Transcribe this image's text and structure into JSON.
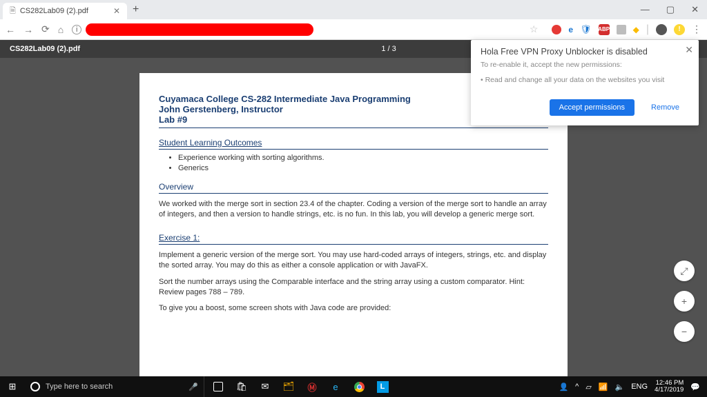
{
  "tab": {
    "title": "CS282Lab09 (2).pdf"
  },
  "windowControls": {
    "min": "—",
    "max": "▢",
    "close": "✕"
  },
  "pdfBar": {
    "filename": "CS282Lab09 (2).pdf",
    "pages": "1 / 3"
  },
  "doc": {
    "title1": "Cuyamaca College CS-282 Intermediate Java Programming",
    "title2": "John Gerstenberg, Instructor",
    "title3": "Lab #9",
    "slo_head": "Student Learning Outcomes",
    "slo1": "Experience working with sorting algorithms.",
    "slo2": "Generics",
    "overview_head": "Overview",
    "overview_body": "We worked with the merge sort in section 23.4 of the chapter. Coding a version of the merge sort to handle an array of integers, and then a version to handle strings, etc. is no fun. In this lab, you will develop a generic merge sort.",
    "ex1_head": "Exercise 1:",
    "ex1_p1": "Implement a generic version of the merge sort. You may use hard-coded arrays of integers, strings, etc. and display the sorted array. You may do this as either a console application or with JavaFX.",
    "ex1_p2": "Sort the number arrays using the Comparable interface and the string array using a custom comparator. Hint: Review pages 788 – 789.",
    "ex1_p3": "To give you a boost, some screen shots with Java code are provided:"
  },
  "popup": {
    "title": "Hola Free VPN Proxy Unblocker is disabled",
    "sub": "To re-enable it, accept the new permissions:",
    "perm": "• Read and change all your data on the websites you visit",
    "accept": "Accept permissions",
    "remove": "Remove"
  },
  "taskbar": {
    "search_placeholder": "Type here to search",
    "lang": "ENG",
    "time": "12:46 PM",
    "date": "4/17/2019"
  },
  "fab": {
    "fit": "⤢",
    "plus": "+",
    "minus": "−"
  }
}
